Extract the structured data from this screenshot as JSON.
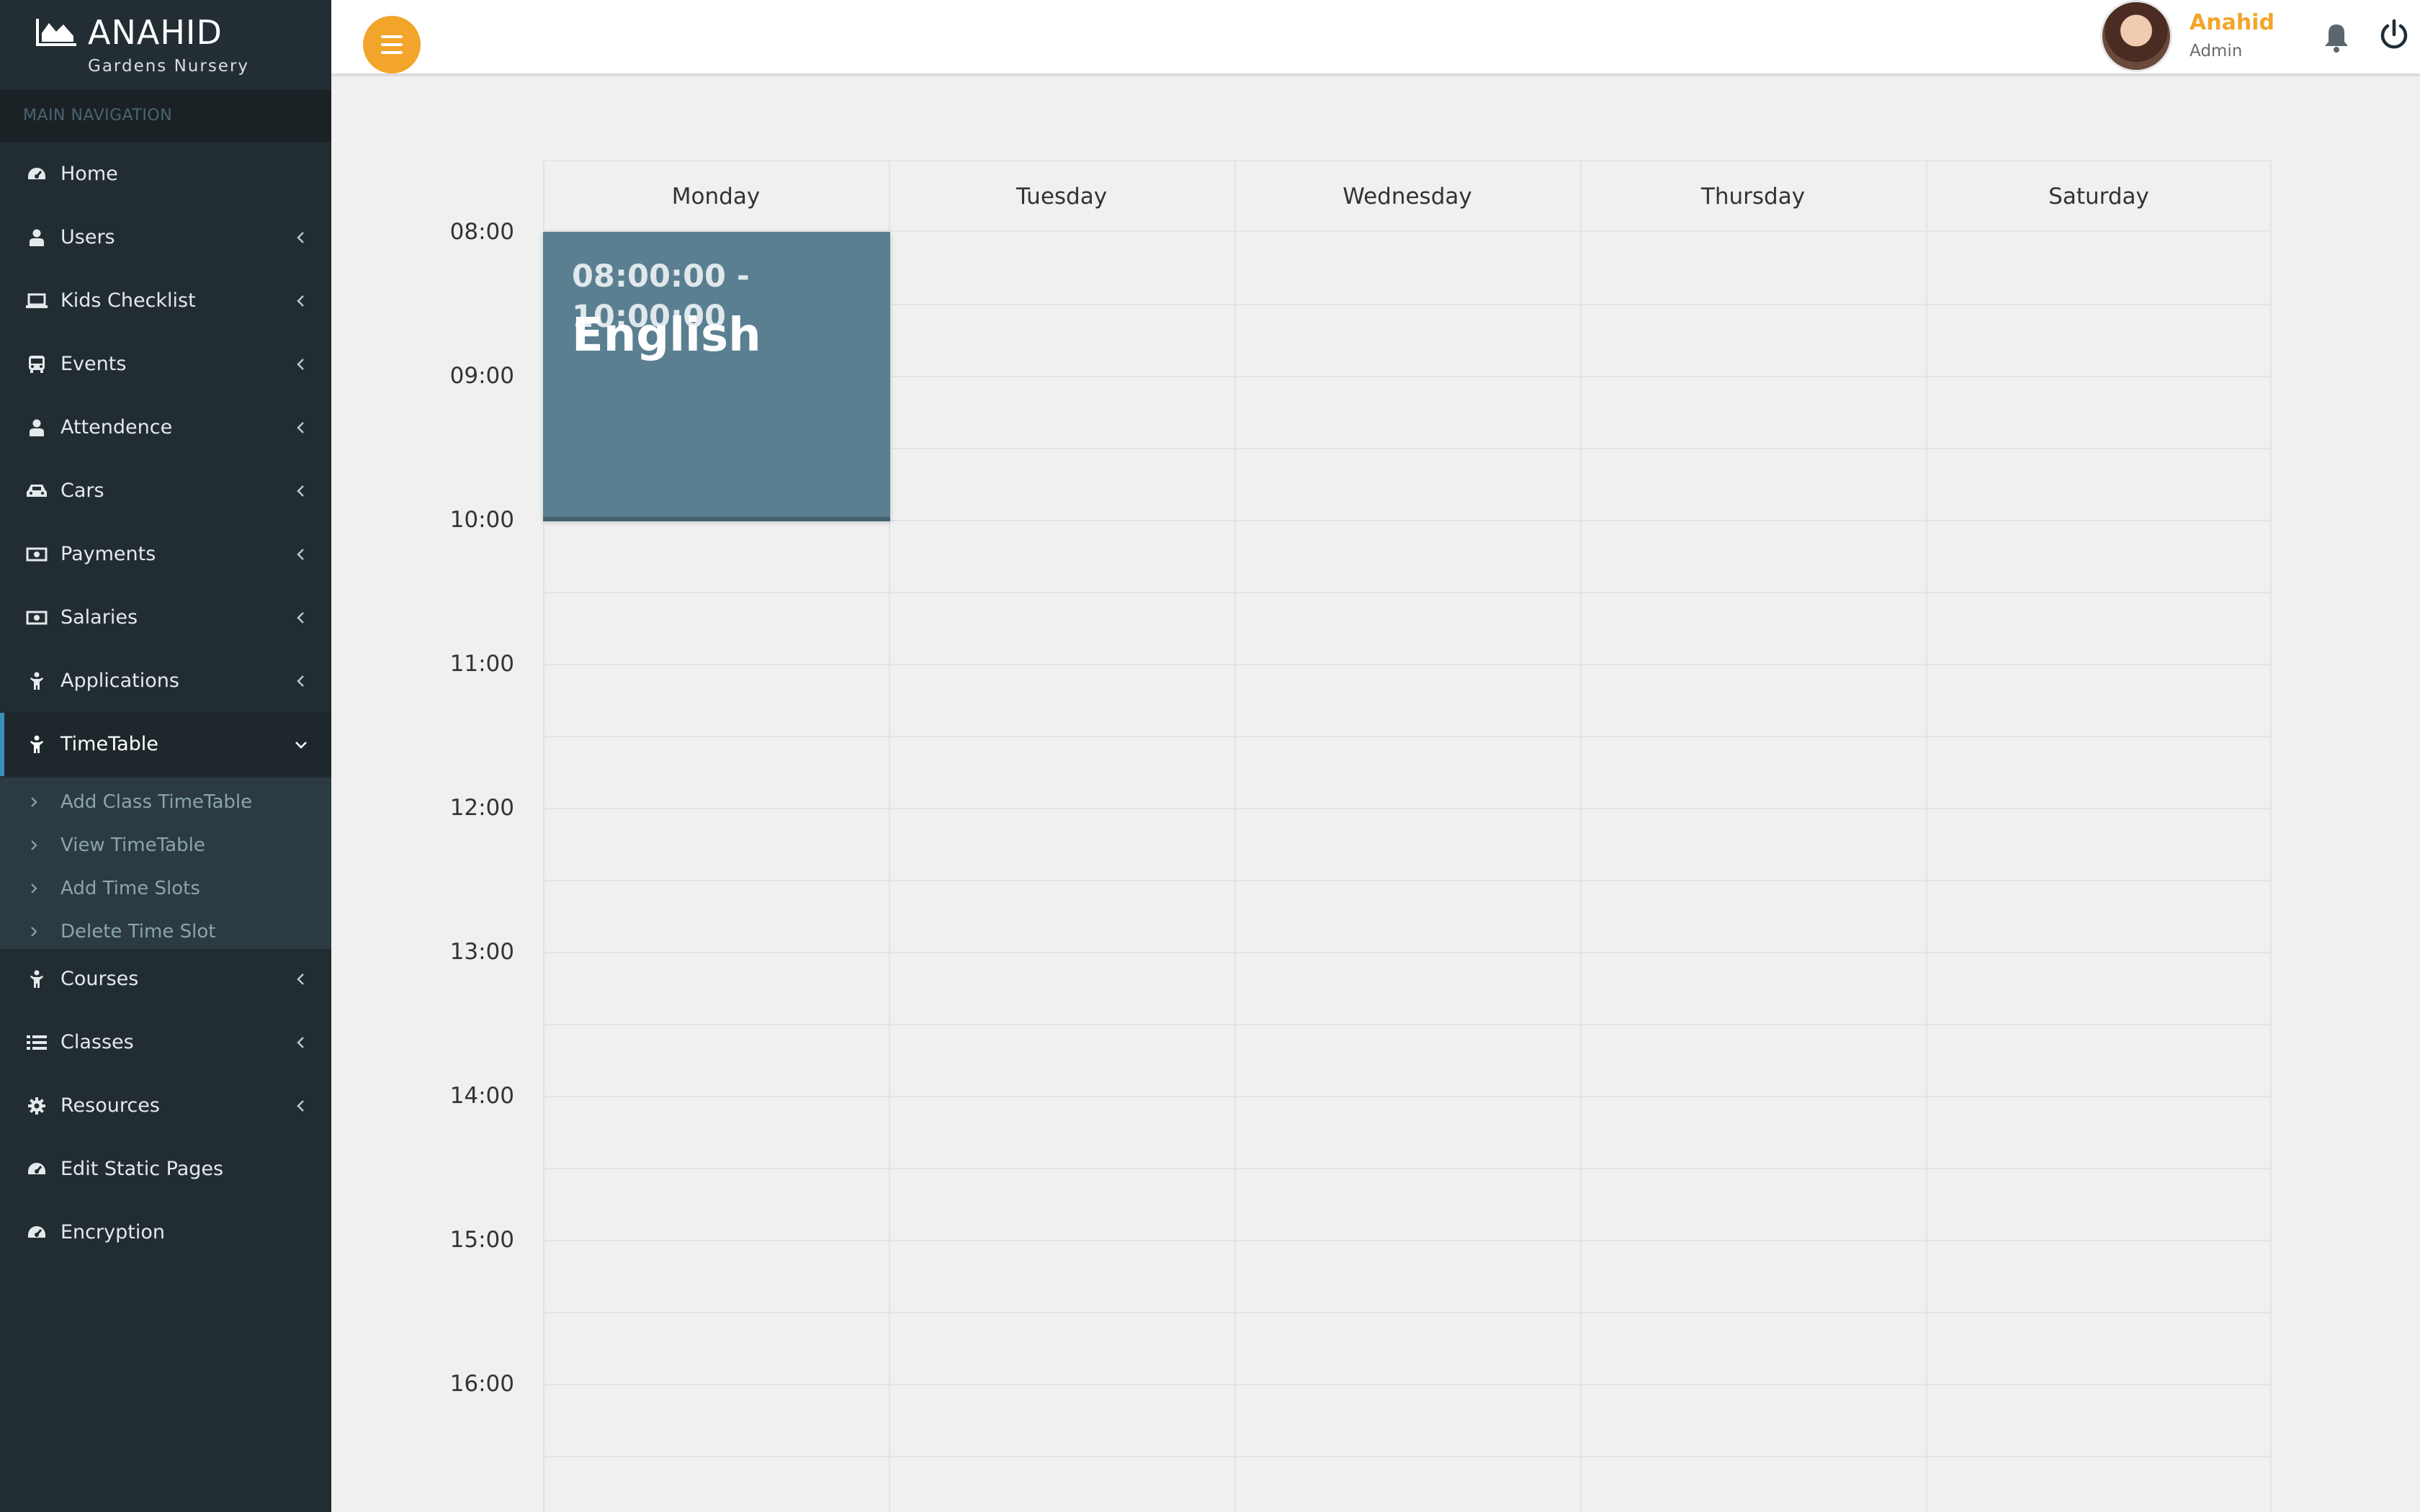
{
  "brand": {
    "title": "ANAHID",
    "subtitle": "Gardens Nursery"
  },
  "sidebar": {
    "header": "MAIN NAVIGATION",
    "items": [
      {
        "label": "Home",
        "icon": "dashboard-icon",
        "has_children": false
      },
      {
        "label": "Users",
        "icon": "user-icon",
        "has_children": true
      },
      {
        "label": "Kids Checklist",
        "icon": "laptop-icon",
        "has_children": true
      },
      {
        "label": "Events",
        "icon": "bus-icon",
        "has_children": true
      },
      {
        "label": "Attendence",
        "icon": "user-icon",
        "has_children": true
      },
      {
        "label": "Cars",
        "icon": "car-icon",
        "has_children": true
      },
      {
        "label": "Payments",
        "icon": "money-icon",
        "has_children": true
      },
      {
        "label": "Salaries",
        "icon": "money-icon",
        "has_children": true
      },
      {
        "label": "Applications",
        "icon": "child-icon",
        "has_children": true
      },
      {
        "label": "TimeTable",
        "icon": "child-icon",
        "has_children": true,
        "active": true
      },
      {
        "label": "Courses",
        "icon": "child-icon",
        "has_children": true
      },
      {
        "label": "Classes",
        "icon": "list-icon",
        "has_children": true
      },
      {
        "label": "Resources",
        "icon": "gear-icon",
        "has_children": true
      },
      {
        "label": "Edit Static Pages",
        "icon": "dashboard-icon",
        "has_children": false
      },
      {
        "label": "Encryption",
        "icon": "dashboard-icon",
        "has_children": false
      }
    ],
    "timetable_submenu": [
      {
        "label": "Add Class TimeTable"
      },
      {
        "label": "View TimeTable"
      },
      {
        "label": "Add Time Slots"
      },
      {
        "label": "Delete Time Slot"
      }
    ]
  },
  "topbar": {
    "menu_icon": "hamburger-icon",
    "user": {
      "name": "Anahid",
      "role": "Admin"
    },
    "notification_icon": "bell-icon",
    "logout_icon": "power-icon"
  },
  "timetable": {
    "days": [
      "Monday",
      "Tuesday",
      "Wednesday",
      "Thursday",
      "Saturday"
    ],
    "times": [
      "08:00",
      "09:00",
      "10:00",
      "11:00",
      "12:00",
      "13:00",
      "14:00",
      "15:00",
      "16:00"
    ],
    "events": [
      {
        "day": "Monday",
        "time_range": "08:00:00 - 10:00:00",
        "title": "English",
        "color": "#5a7f91"
      }
    ]
  },
  "colors": {
    "sidebar_bg": "#222d32",
    "accent_orange": "#f2a52a",
    "active_border": "#3c8dbc",
    "event_bg": "#5a7f91"
  }
}
